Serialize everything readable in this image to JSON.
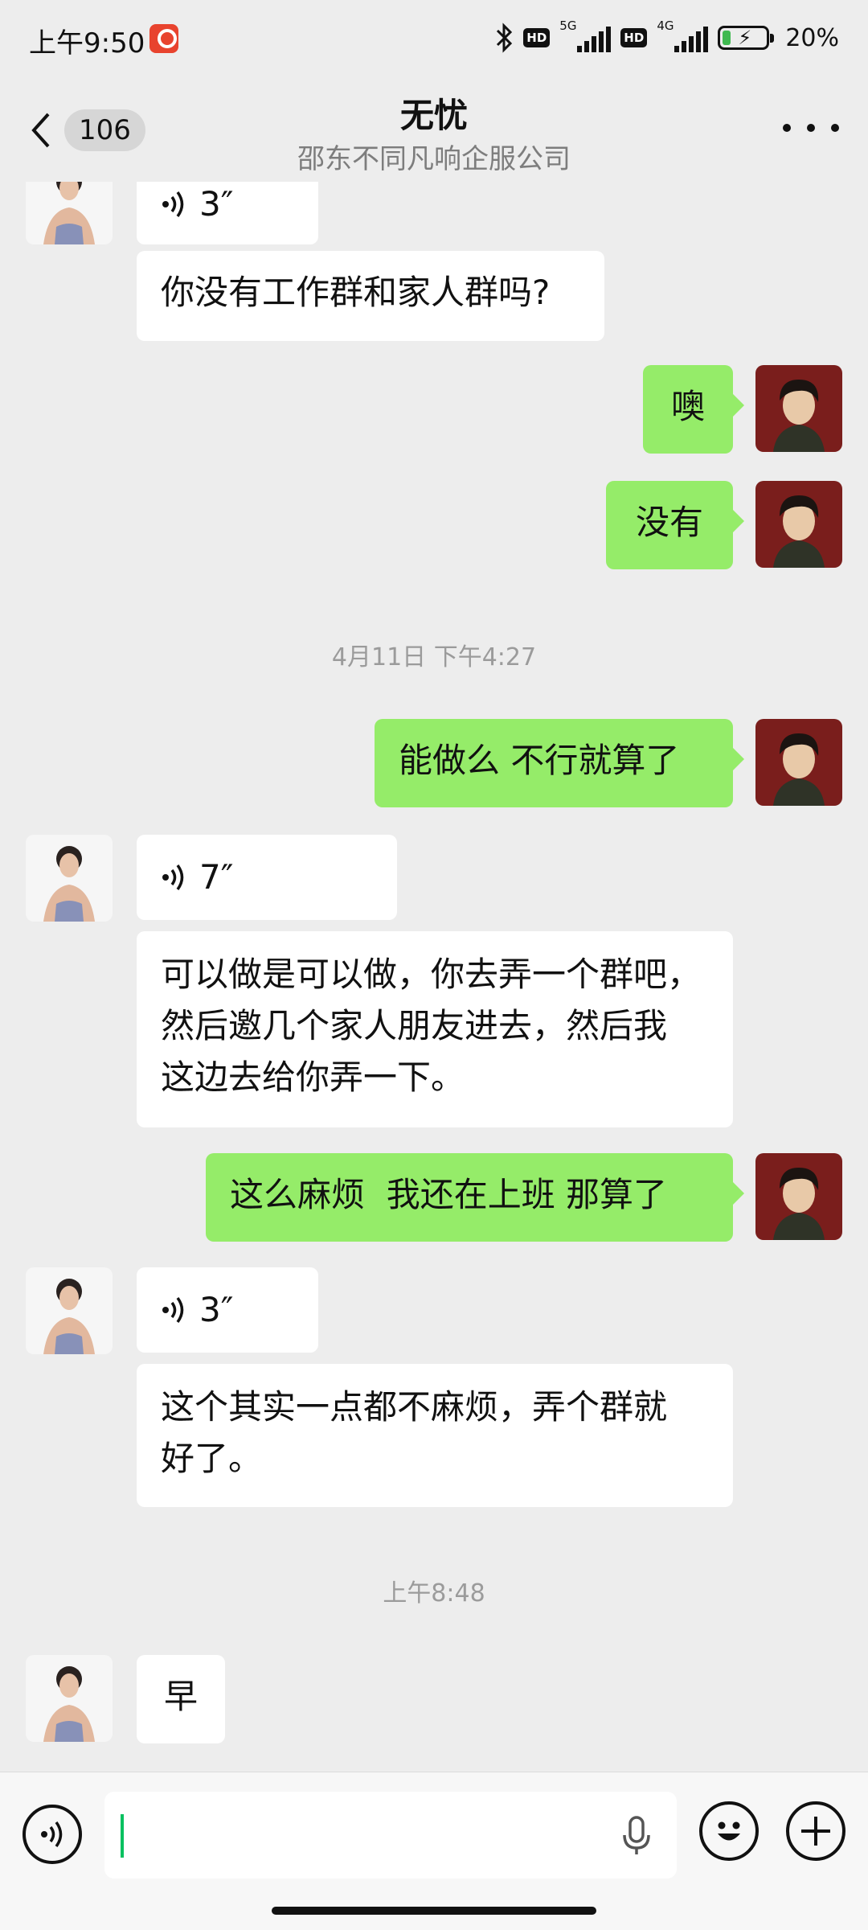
{
  "status_bar": {
    "time": "上午9:50",
    "hd1": "HD",
    "net1": "5G",
    "hd2": "HD",
    "net2": "4G",
    "battery_percent": "20%",
    "battery_level": 0.2,
    "icons": [
      "carrier-app-icon",
      "bluetooth-icon",
      "signal-icon",
      "battery-charging-icon"
    ]
  },
  "header": {
    "back_label": "",
    "unread_count": "106",
    "title": "无忧",
    "subtitle": "邵东不同凡响企服公司",
    "more_icon": "more-dots-icon"
  },
  "messages": [
    {
      "side": "in",
      "type": "voice",
      "text": "3″"
    },
    {
      "side": "in",
      "type": "text",
      "text": "你没有工作群和家人群吗?"
    },
    {
      "side": "out",
      "type": "text",
      "text": "噢"
    },
    {
      "side": "out",
      "type": "text",
      "text": "没有"
    },
    {
      "side": "system",
      "type": "time",
      "text": "4月11日 下午4:27"
    },
    {
      "side": "out",
      "type": "text",
      "text": "能做么 不行就算了"
    },
    {
      "side": "in",
      "type": "voice",
      "text": "7″"
    },
    {
      "side": "in",
      "type": "text",
      "text": "可以做是可以做，你去弄一个群吧，\n然后邀几个家人朋友进去，然后我\n这边去给你弄一下。"
    },
    {
      "side": "out",
      "type": "text",
      "text": "这么麻烦  我还在上班 那算了"
    },
    {
      "side": "in",
      "type": "voice",
      "text": "3″"
    },
    {
      "side": "in",
      "type": "text",
      "text": "这个其实一点都不麻烦，弄个群就\n好了。"
    },
    {
      "side": "system",
      "type": "time",
      "text": "上午8:48"
    },
    {
      "side": "in",
      "type": "text",
      "text": "早"
    }
  ],
  "input_bar": {
    "value": "",
    "icons": [
      "voice-mode-icon",
      "microphone-icon",
      "emoji-icon",
      "plus-icon"
    ]
  },
  "colors": {
    "background": "#ededed",
    "incoming_bubble": "#ffffff",
    "outgoing_bubble": "#95ec69",
    "timestamp_text": "#9b9b9b",
    "accent": "#07c160"
  }
}
